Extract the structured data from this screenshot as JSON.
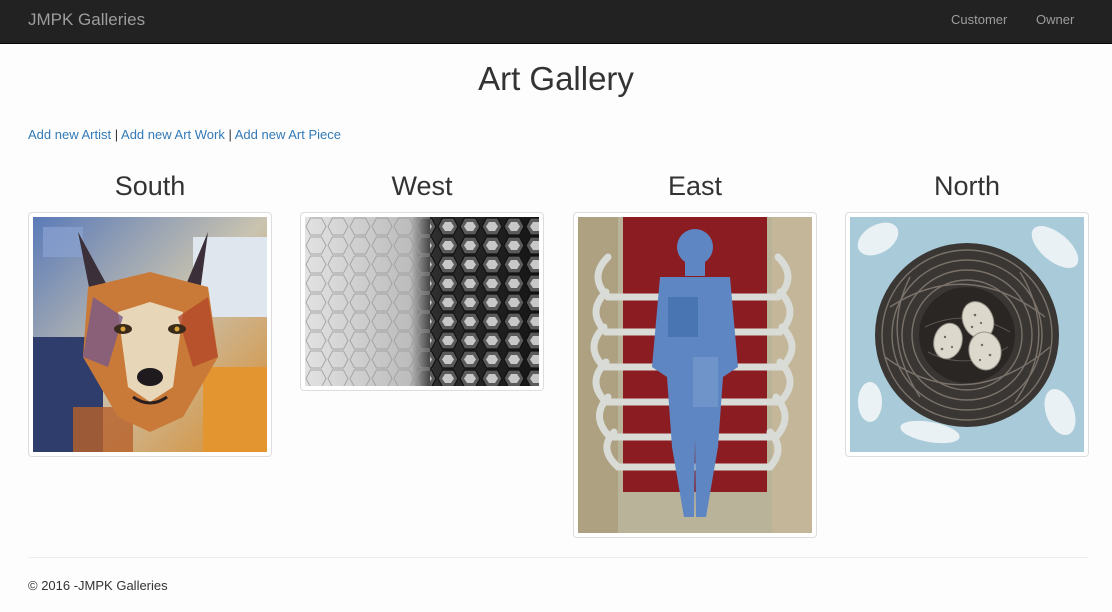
{
  "navbar": {
    "brand": "JMPK Galleries",
    "links": [
      "Customer",
      "Owner"
    ]
  },
  "page": {
    "title": "Art Gallery",
    "admin_links": {
      "artist": "Add new Artist",
      "work": "Add new Art Work",
      "piece": "Add new Art Piece",
      "separator": "|"
    }
  },
  "galleries": [
    {
      "label": "South",
      "image": "wolf-painting"
    },
    {
      "label": "West",
      "image": "hexagon-pattern"
    },
    {
      "label": "East",
      "image": "ribcage-figure-print"
    },
    {
      "label": "North",
      "image": "nest-with-eggs"
    }
  ],
  "footer": {
    "text": "© 2016 -JMPK Galleries"
  },
  "colors": {
    "navbar_bg": "#222222",
    "navbar_text": "#9d9d9d",
    "link": "#337ab7"
  }
}
